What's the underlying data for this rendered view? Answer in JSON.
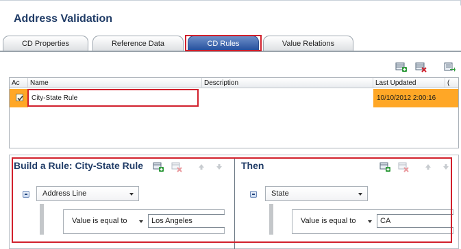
{
  "page": {
    "title": "Address Validation"
  },
  "tabs": [
    {
      "label": "CD Properties",
      "active": false
    },
    {
      "label": "Reference Data",
      "active": false
    },
    {
      "label": "CD Rules",
      "active": true
    },
    {
      "label": "Value Relations",
      "active": false
    }
  ],
  "toolbar": {
    "icons": [
      "add-rule-icon",
      "delete-rule-icon",
      "export-rule-icon"
    ]
  },
  "grid": {
    "columns": [
      "Ac",
      "Name",
      "Description",
      "Last Updated",
      "("
    ],
    "rows": [
      {
        "active": true,
        "name": "City-State Rule",
        "description": "",
        "last_updated": "10/10/2012 2:00:16"
      }
    ]
  },
  "builder": {
    "title": "Build a Rule: City-State Rule",
    "field": "Address Line",
    "operator": "Value is equal to",
    "value": "Los Angeles"
  },
  "then": {
    "title": "Then",
    "field": "State",
    "operator": "Value is equal to",
    "value": "CA"
  },
  "colors": {
    "accent": "#1f3b66",
    "highlight": "#d11f2b",
    "selected_row": "#ffa726",
    "active_tab": "#1f4b9a"
  }
}
